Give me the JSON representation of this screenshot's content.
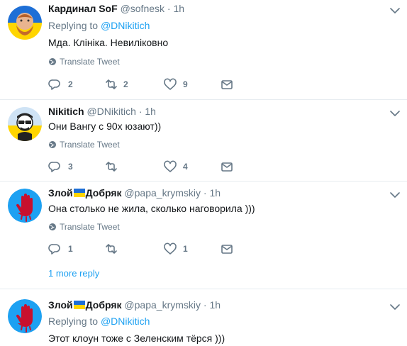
{
  "tweets": [
    {
      "name": "Кардинал SoF",
      "handle": "@sofnesk",
      "dot": "·",
      "time": "1h",
      "replying_prefix": "Replying to",
      "replying_to": "@DNikitich",
      "text": "Мда. Клініка. Невиліковно",
      "translate": "Translate Tweet",
      "replies": "2",
      "retweets": "2",
      "likes": "9"
    },
    {
      "name": "Nikitich",
      "handle": "@DNikitich",
      "dot": "·",
      "time": "1h",
      "text": "Они Вангу с 90х юзают))",
      "translate": "Translate Tweet",
      "replies": "3",
      "retweets": "",
      "likes": "4"
    },
    {
      "name_left": "Злой",
      "name_right": "Добряк",
      "handle": "@papa_krymskiy",
      "dot": "·",
      "time": "1h",
      "text": "Она столько не жила, сколько наговорила )))",
      "translate": "Translate Tweet",
      "replies": "1",
      "retweets": "",
      "likes": "1"
    },
    {
      "name_left": "Злой",
      "name_right": "Добряк",
      "handle": "@papa_krymskiy",
      "dot": "·",
      "time": "1h",
      "replying_prefix": "Replying to",
      "replying_to": "@DNikitich",
      "text": "Этот клоун тоже с Зеленским тёрся )))"
    }
  ],
  "more_replies": "1 more reply",
  "colors": {
    "link": "#1da1f2",
    "muted": "#657786",
    "separator": "#e6ecf0"
  }
}
